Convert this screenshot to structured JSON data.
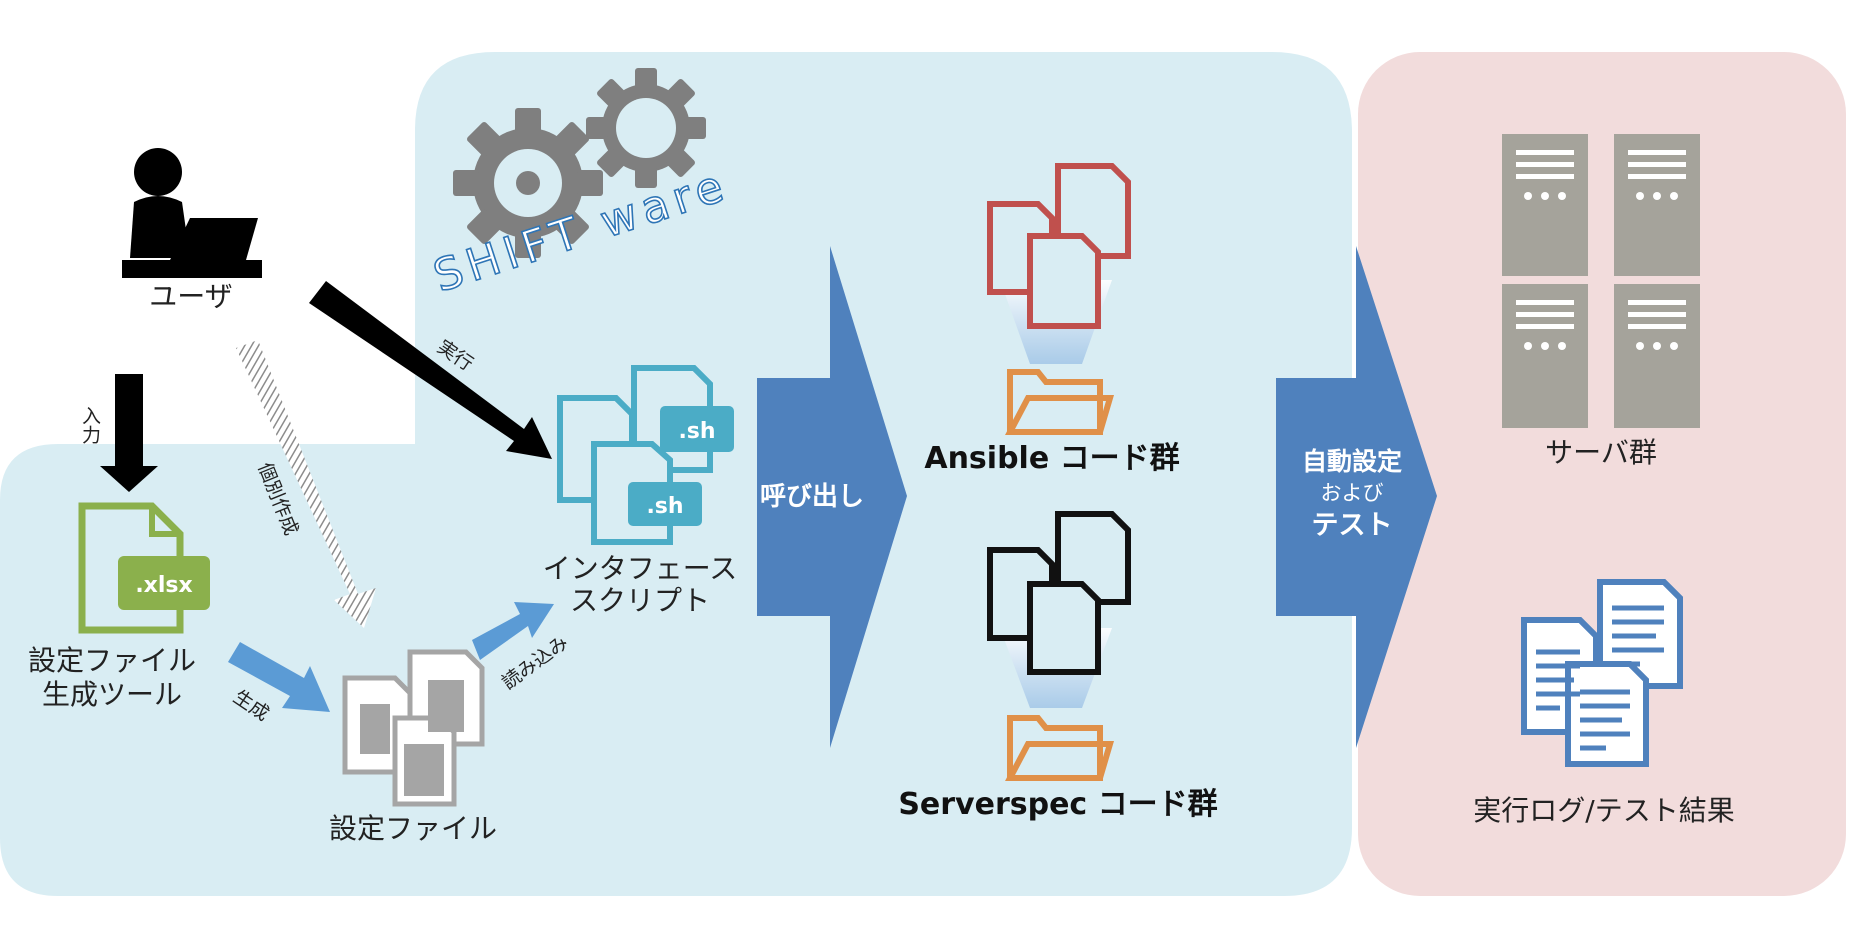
{
  "brand": {
    "name": "SHIFT ware"
  },
  "actors": {
    "user": "ユーザ"
  },
  "files": {
    "xlsx_badge": ".xlsx",
    "tool_label_line1": "設定ファイル",
    "tool_label_line2": "生成ツール",
    "config_label": "設定ファイル",
    "sh_badge_1": ".sh",
    "sh_badge_2": ".sh",
    "interface_line1": "インタフェース",
    "interface_line2": "スクリプト"
  },
  "arrows": {
    "input": "入力",
    "execute": "実行",
    "individual": "個別作成",
    "generate": "生成",
    "read": "読み込み",
    "call": "呼び出し",
    "auto_line1": "自動設定",
    "auto_line2": "および",
    "auto_line3": "テスト"
  },
  "code_groups": {
    "ansible": "Ansible コード群",
    "serverspec": "Serverspec コード群"
  },
  "targets": {
    "servers": "サーバ群",
    "logs": "実行ログ/テスト結果"
  },
  "colors": {
    "blue_region": "#d9edf3",
    "pink_region": "#f2dcdc",
    "big_arrow": "#4f81bd",
    "green_file": "#8bb04c",
    "teal_file": "#4bacc6",
    "red_file": "#c0504d",
    "folder": "#e09048",
    "server": "#a5a39b",
    "log_doc": "#4f81bd",
    "gear": "#7f7f7f"
  }
}
